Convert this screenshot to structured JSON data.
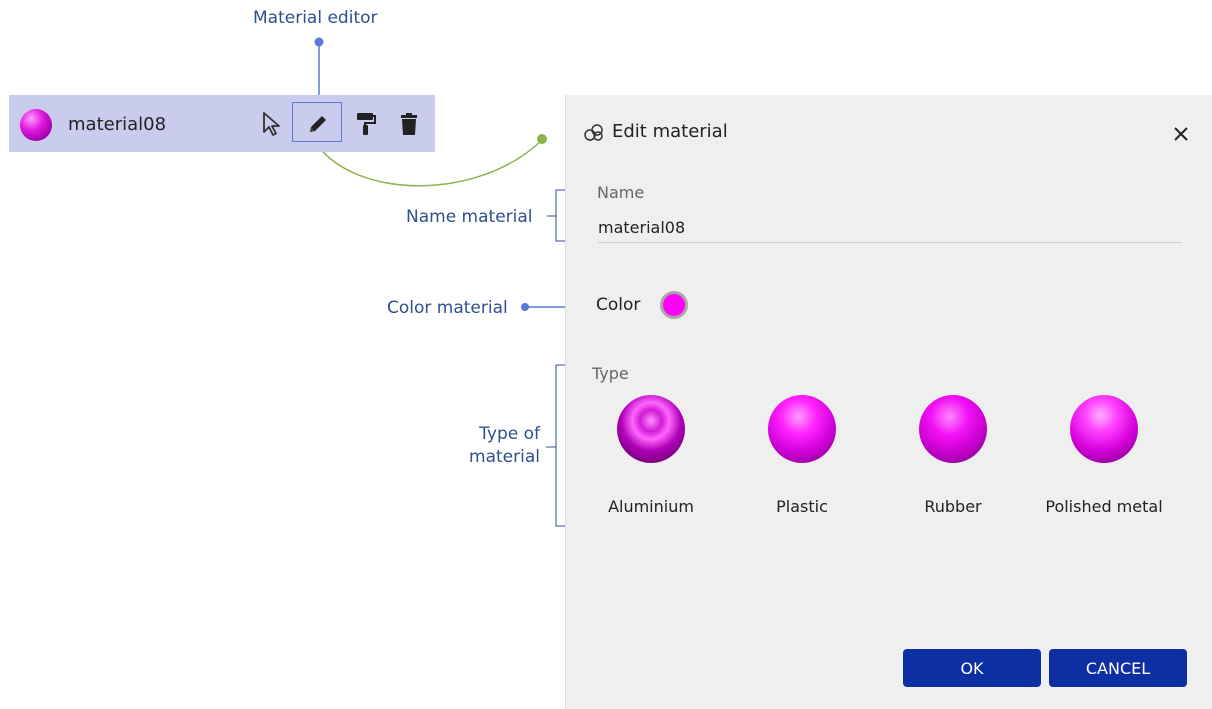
{
  "annotations": {
    "material_editor": "Material editor",
    "name_material": "Name material",
    "color_material": "Color material",
    "type_of_material_line1": "Type of",
    "type_of_material_line2": "material"
  },
  "material_row": {
    "name": "material08",
    "swatch_color": "#d400d4",
    "icons": [
      "cursor-icon",
      "pencil-icon",
      "paint-roller-icon",
      "trash-icon"
    ]
  },
  "dialog": {
    "title": "Edit material",
    "title_icon": "material-cloud-icon",
    "name_label": "Name",
    "name_value": "material08",
    "color_label": "Color",
    "color_value": "#ff00f6",
    "type_label": "Type",
    "types": [
      "Aluminium",
      "Plastic",
      "Rubber",
      "Polished metal"
    ],
    "ok_label": "OK",
    "cancel_label": "CANCEL"
  },
  "colors": {
    "row_background": "#c9ccec",
    "dialog_background": "#efefef",
    "primary_button": "#0d2fa3",
    "annotation_text": "#2f4f8f",
    "callout_blue": "#5a78d6",
    "callout_green": "#8db34e"
  }
}
